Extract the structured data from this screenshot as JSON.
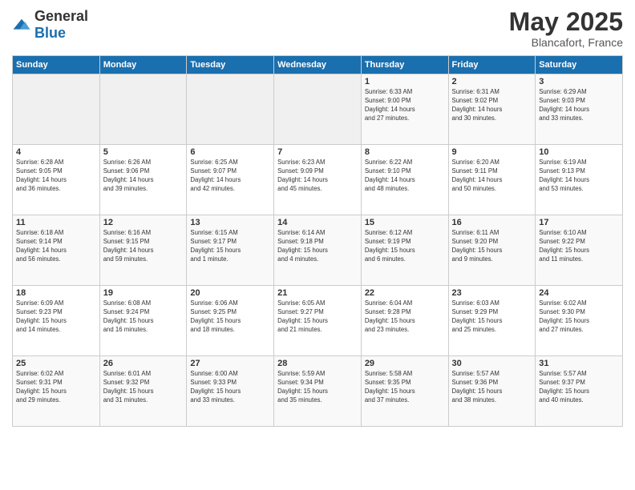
{
  "header": {
    "logo": {
      "general": "General",
      "blue": "Blue"
    },
    "month": "May 2025",
    "location": "Blancafort, France"
  },
  "weekdays": [
    "Sunday",
    "Monday",
    "Tuesday",
    "Wednesday",
    "Thursday",
    "Friday",
    "Saturday"
  ],
  "weeks": [
    [
      {
        "day": "",
        "info": ""
      },
      {
        "day": "",
        "info": ""
      },
      {
        "day": "",
        "info": ""
      },
      {
        "day": "",
        "info": ""
      },
      {
        "day": "1",
        "info": "Sunrise: 6:33 AM\nSunset: 9:00 PM\nDaylight: 14 hours\nand 27 minutes."
      },
      {
        "day": "2",
        "info": "Sunrise: 6:31 AM\nSunset: 9:02 PM\nDaylight: 14 hours\nand 30 minutes."
      },
      {
        "day": "3",
        "info": "Sunrise: 6:29 AM\nSunset: 9:03 PM\nDaylight: 14 hours\nand 33 minutes."
      }
    ],
    [
      {
        "day": "4",
        "info": "Sunrise: 6:28 AM\nSunset: 9:05 PM\nDaylight: 14 hours\nand 36 minutes."
      },
      {
        "day": "5",
        "info": "Sunrise: 6:26 AM\nSunset: 9:06 PM\nDaylight: 14 hours\nand 39 minutes."
      },
      {
        "day": "6",
        "info": "Sunrise: 6:25 AM\nSunset: 9:07 PM\nDaylight: 14 hours\nand 42 minutes."
      },
      {
        "day": "7",
        "info": "Sunrise: 6:23 AM\nSunset: 9:09 PM\nDaylight: 14 hours\nand 45 minutes."
      },
      {
        "day": "8",
        "info": "Sunrise: 6:22 AM\nSunset: 9:10 PM\nDaylight: 14 hours\nand 48 minutes."
      },
      {
        "day": "9",
        "info": "Sunrise: 6:20 AM\nSunset: 9:11 PM\nDaylight: 14 hours\nand 50 minutes."
      },
      {
        "day": "10",
        "info": "Sunrise: 6:19 AM\nSunset: 9:13 PM\nDaylight: 14 hours\nand 53 minutes."
      }
    ],
    [
      {
        "day": "11",
        "info": "Sunrise: 6:18 AM\nSunset: 9:14 PM\nDaylight: 14 hours\nand 56 minutes."
      },
      {
        "day": "12",
        "info": "Sunrise: 6:16 AM\nSunset: 9:15 PM\nDaylight: 14 hours\nand 59 minutes."
      },
      {
        "day": "13",
        "info": "Sunrise: 6:15 AM\nSunset: 9:17 PM\nDaylight: 15 hours\nand 1 minute."
      },
      {
        "day": "14",
        "info": "Sunrise: 6:14 AM\nSunset: 9:18 PM\nDaylight: 15 hours\nand 4 minutes."
      },
      {
        "day": "15",
        "info": "Sunrise: 6:12 AM\nSunset: 9:19 PM\nDaylight: 15 hours\nand 6 minutes."
      },
      {
        "day": "16",
        "info": "Sunrise: 6:11 AM\nSunset: 9:20 PM\nDaylight: 15 hours\nand 9 minutes."
      },
      {
        "day": "17",
        "info": "Sunrise: 6:10 AM\nSunset: 9:22 PM\nDaylight: 15 hours\nand 11 minutes."
      }
    ],
    [
      {
        "day": "18",
        "info": "Sunrise: 6:09 AM\nSunset: 9:23 PM\nDaylight: 15 hours\nand 14 minutes."
      },
      {
        "day": "19",
        "info": "Sunrise: 6:08 AM\nSunset: 9:24 PM\nDaylight: 15 hours\nand 16 minutes."
      },
      {
        "day": "20",
        "info": "Sunrise: 6:06 AM\nSunset: 9:25 PM\nDaylight: 15 hours\nand 18 minutes."
      },
      {
        "day": "21",
        "info": "Sunrise: 6:05 AM\nSunset: 9:27 PM\nDaylight: 15 hours\nand 21 minutes."
      },
      {
        "day": "22",
        "info": "Sunrise: 6:04 AM\nSunset: 9:28 PM\nDaylight: 15 hours\nand 23 minutes."
      },
      {
        "day": "23",
        "info": "Sunrise: 6:03 AM\nSunset: 9:29 PM\nDaylight: 15 hours\nand 25 minutes."
      },
      {
        "day": "24",
        "info": "Sunrise: 6:02 AM\nSunset: 9:30 PM\nDaylight: 15 hours\nand 27 minutes."
      }
    ],
    [
      {
        "day": "25",
        "info": "Sunrise: 6:02 AM\nSunset: 9:31 PM\nDaylight: 15 hours\nand 29 minutes."
      },
      {
        "day": "26",
        "info": "Sunrise: 6:01 AM\nSunset: 9:32 PM\nDaylight: 15 hours\nand 31 minutes."
      },
      {
        "day": "27",
        "info": "Sunrise: 6:00 AM\nSunset: 9:33 PM\nDaylight: 15 hours\nand 33 minutes."
      },
      {
        "day": "28",
        "info": "Sunrise: 5:59 AM\nSunset: 9:34 PM\nDaylight: 15 hours\nand 35 minutes."
      },
      {
        "day": "29",
        "info": "Sunrise: 5:58 AM\nSunset: 9:35 PM\nDaylight: 15 hours\nand 37 minutes."
      },
      {
        "day": "30",
        "info": "Sunrise: 5:57 AM\nSunset: 9:36 PM\nDaylight: 15 hours\nand 38 minutes."
      },
      {
        "day": "31",
        "info": "Sunrise: 5:57 AM\nSunset: 9:37 PM\nDaylight: 15 hours\nand 40 minutes."
      }
    ]
  ]
}
